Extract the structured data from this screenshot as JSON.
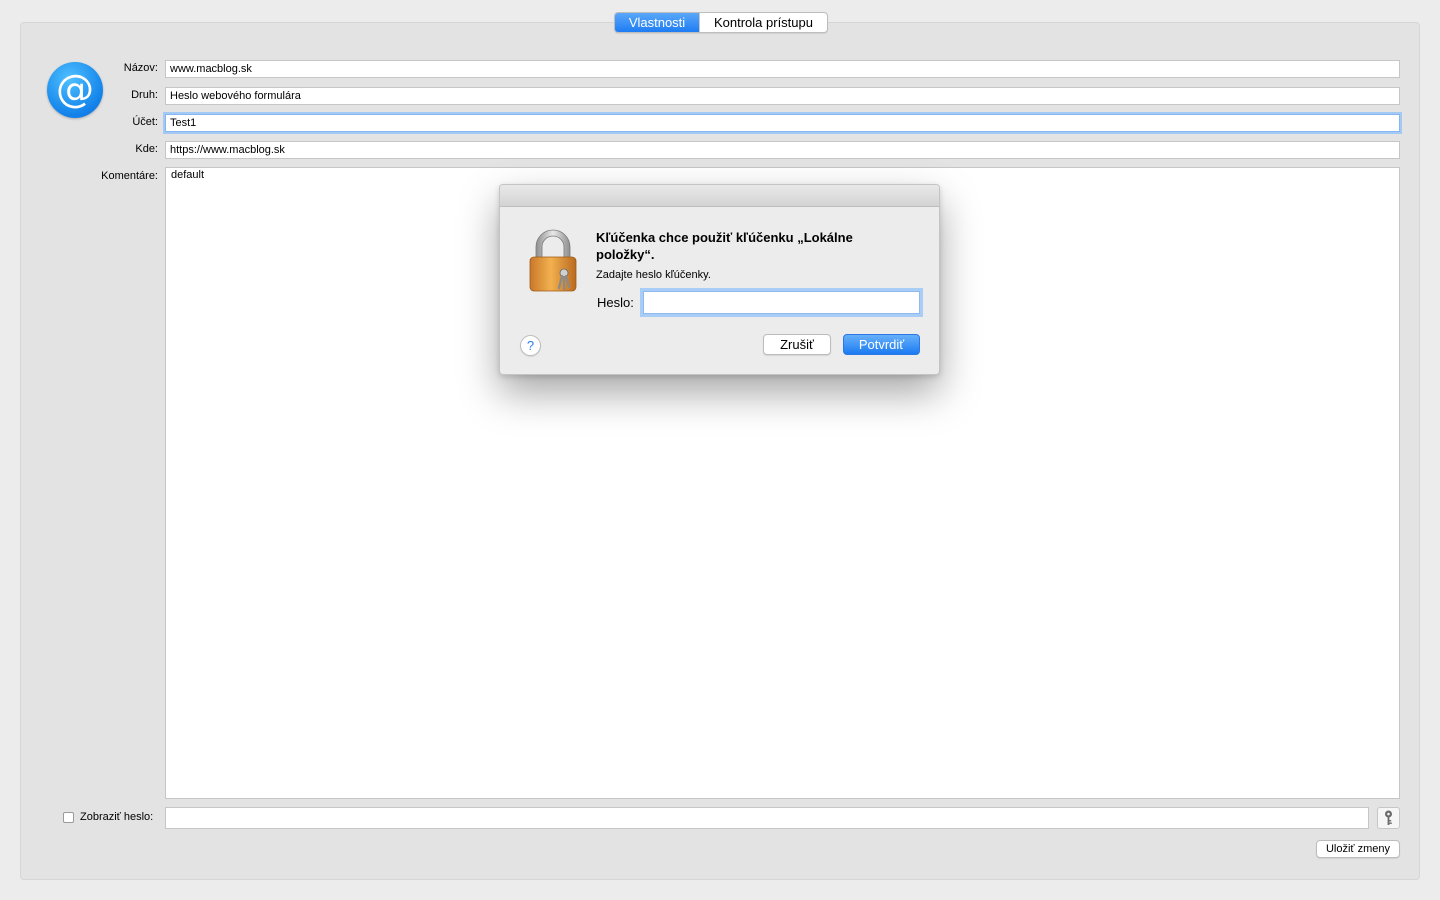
{
  "tabs": [
    {
      "label": "Vlastnosti",
      "active": true
    },
    {
      "label": "Kontrola prístupu",
      "active": false
    }
  ],
  "item": {
    "icon": "at-sign-icon",
    "name_label": "Názov:",
    "name_value": "www.macblog.sk",
    "kind_label": "Druh:",
    "kind_value": "Heslo webového formulára",
    "account_label": "Účet:",
    "account_value": "Test1",
    "where_label": "Kde:",
    "where_value": "https://www.macblog.sk",
    "comments_label": "Komentáre:",
    "comments_value": "default",
    "show_password_label": "Zobraziť heslo:",
    "show_password_checked": false,
    "save_label": "Uložiť zmeny"
  },
  "dialog": {
    "icon": "lock-keys-icon",
    "title": "Kľúčenka chce použiť kľúčenku „Lokálne položky“.",
    "subtitle": "Zadajte heslo kľúčenky.",
    "password_label": "Heslo:",
    "password_value": "",
    "help_label": "?",
    "cancel_label": "Zrušiť",
    "confirm_label": "Potvrdiť"
  },
  "colors": {
    "accent": "#1e7df3",
    "panel_bg": "#e3e3e3",
    "window_bg": "#ececec"
  }
}
